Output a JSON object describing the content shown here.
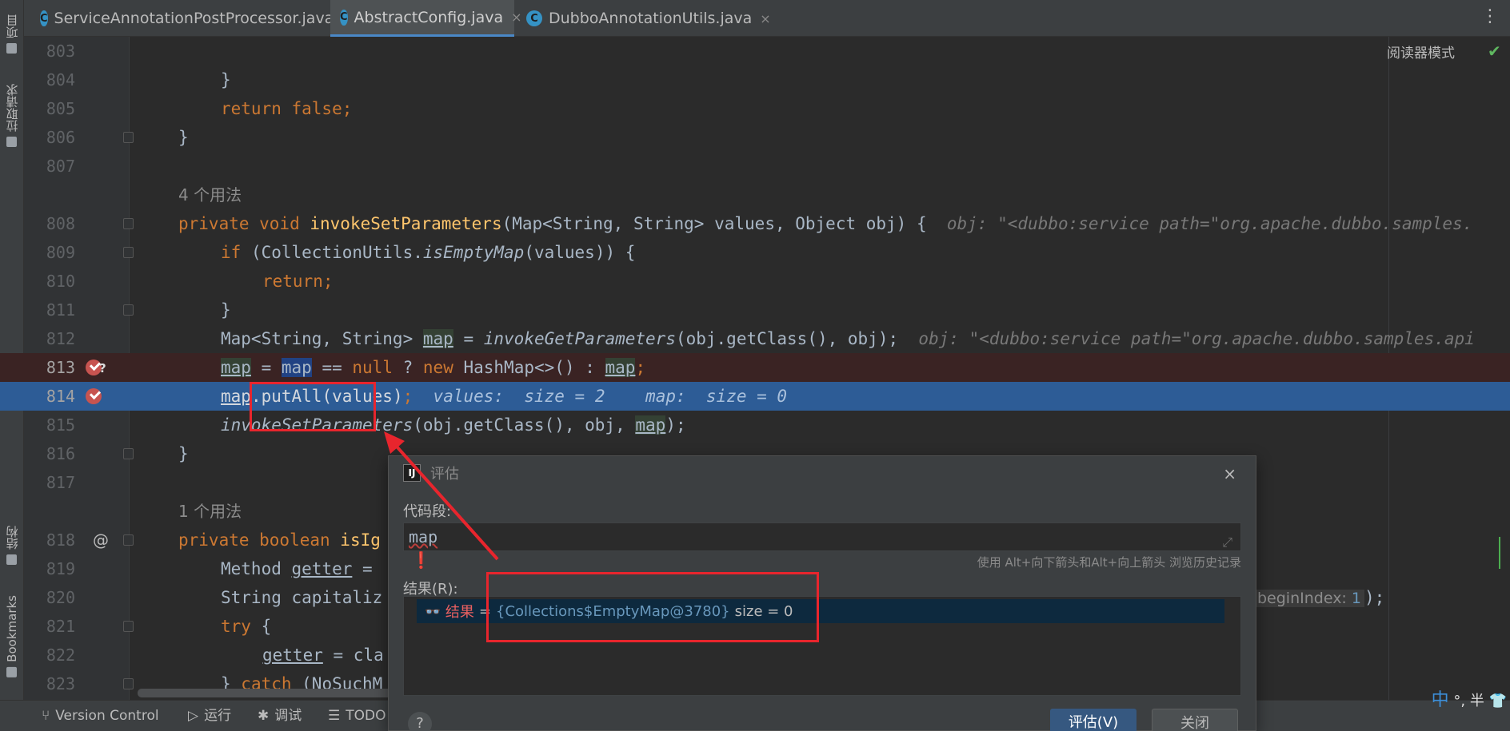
{
  "sidebar": {
    "items": [
      {
        "label": "项目",
        "icon": "folder-icon"
      },
      {
        "label": "拉取请求",
        "icon": "pull-request-icon"
      },
      {
        "label": "结构",
        "icon": "structure-icon"
      },
      {
        "label": "Bookmarks",
        "icon": "bookmark-icon"
      }
    ]
  },
  "tabs": [
    {
      "label": "ServiceAnnotationPostProcessor.java",
      "icon_letter": "C",
      "close": "×"
    },
    {
      "label": "AbstractConfig.java",
      "icon_letter": "C",
      "close": "×"
    },
    {
      "label": "DubboAnnotationUtils.java",
      "icon_letter": "C",
      "close": "×"
    }
  ],
  "editor": {
    "reader_mode": "阅读器模式",
    "lines": {
      "l803": {
        "num": "803"
      },
      "l804": {
        "num": "804",
        "text": "}"
      },
      "l805": {
        "num": "805",
        "kw": "return false",
        "end": ";"
      },
      "l806": {
        "num": "806",
        "text": "}"
      },
      "l807": {
        "num": "807"
      },
      "usage1": "4 个用法",
      "l808": {
        "num": "808",
        "k1": "private void ",
        "fn": "invokeSetParameters",
        "rest": "(Map<String, String> values, Object obj) {",
        "hint": "obj: \"<dubbo:service path=\"org.apache.dubbo.samples."
      },
      "l809": {
        "num": "809",
        "k1": "if ",
        "p1": "(CollectionUtils.",
        "it": "isEmptyMap",
        "p2": "(values)) {"
      },
      "l810": {
        "num": "810",
        "kw": "return",
        "end": ";"
      },
      "l811": {
        "num": "811",
        "text": "}"
      },
      "l812": {
        "num": "812",
        "p1": "Map<String, String> ",
        "v": "map",
        "p2": " = ",
        "it": "invokeGetParameters",
        "p3": "(obj.getClass(), obj);",
        "hint": "obj: \"<dubbo:service path=\"org.apache.dubbo.samples.api"
      },
      "l813": {
        "num": "813",
        "v1": "map",
        "p1": " = ",
        "v2": "map",
        "p2": " == ",
        "k1": "null",
        "p3": " ? ",
        "k2": "new ",
        "p4": "HashMap<>() : ",
        "v3": "map",
        "end": ";"
      },
      "l814": {
        "num": "814",
        "v": "map",
        "p1": ".putAll(values)",
        "end": ";",
        "hint": "values:  size = 2    map:  size = 0"
      },
      "l815": {
        "num": "815",
        "it": "invokeSetParameters",
        "p1": "(obj.getClass(), obj, ",
        "v": "map",
        "p2": ");"
      },
      "l816": {
        "num": "816",
        "text": "}"
      },
      "l817": {
        "num": "817"
      },
      "usage2": "1 个用法",
      "l818": {
        "num": "818",
        "k1": "private boolean ",
        "fn": "isIg"
      },
      "l819": {
        "num": "819",
        "p1": "Method ",
        "v": "getter",
        "p2": " = "
      },
      "l820": {
        "num": "820",
        "p1": "String capitaliz",
        "tail_hint": "beginIndex:",
        "tail_num": "1",
        "tail_end": ");"
      },
      "l821": {
        "num": "821",
        "k1": "try",
        "p1": " {"
      },
      "l822": {
        "num": "822",
        "v": "getter",
        "p1": " = cla"
      },
      "l823": {
        "num": "823",
        "p1": "} ",
        "k1": "catch",
        "p2": " (NoSuchM"
      }
    }
  },
  "dialog": {
    "title": "评估",
    "close": "×",
    "code_label": "代码段:",
    "expression": "map",
    "history_hint": "使用 Alt+向下箭头和Alt+向上箭头 浏览历史记录",
    "result_label": "结果(R):",
    "result": {
      "name": "结果",
      "eq": " = ",
      "value": "{Collections$EmptyMap@3780}",
      "size": "size = 0"
    },
    "help": "?",
    "evaluate_button": "评估(V)",
    "close_button": "关闭"
  },
  "bottom_bar": [
    {
      "label": "Version Control",
      "icon": "branch-icon"
    },
    {
      "label": "运行",
      "icon": "run-icon"
    },
    {
      "label": "调试",
      "icon": "debug-icon"
    },
    {
      "label": "TODO",
      "icon": "todo-icon"
    }
  ],
  "ime": {
    "lang": "中",
    "mode": "°, 半"
  }
}
